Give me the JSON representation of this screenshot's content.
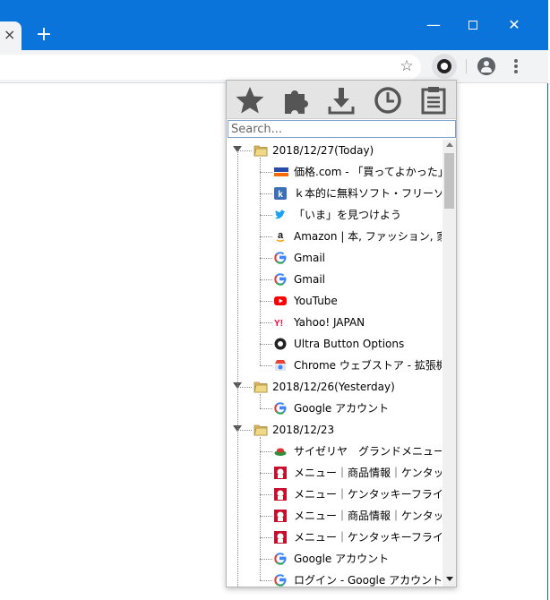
{
  "browser": {
    "tab_close": "×",
    "new_tab": "+",
    "window_controls": {
      "minimize": "—",
      "close": "✕"
    }
  },
  "popup": {
    "toolbar_icons": [
      "star-icon",
      "puzzle-icon",
      "download-icon",
      "clock-icon",
      "clipboard-icon"
    ],
    "search_placeholder": "Search...",
    "groups": [
      {
        "label": "2018/12/27(Today)",
        "items": [
          {
            "label": "価格.com - 「買ってよかった」",
            "icon": "kakaku-favicon"
          },
          {
            "label": "ｋ本的に無料ソフト・フリーソ",
            "icon": "k-favicon"
          },
          {
            "label": "「いま」を見つけよう",
            "icon": "twitter-favicon"
          },
          {
            "label": "Amazon | 本, ファッション, 家電",
            "icon": "amazon-favicon"
          },
          {
            "label": "Gmail",
            "icon": "google-favicon"
          },
          {
            "label": "Gmail",
            "icon": "google-favicon"
          },
          {
            "label": "YouTube",
            "icon": "youtube-favicon"
          },
          {
            "label": "Yahoo! JAPAN",
            "icon": "yahoo-favicon"
          },
          {
            "label": "Ultra Button Options",
            "icon": "ultrabutton-favicon"
          },
          {
            "label": "Chrome ウェブストア - 拡張機能",
            "icon": "webstore-favicon"
          }
        ]
      },
      {
        "label": "2018/12/26(Yesterday)",
        "items": [
          {
            "label": "Google アカウント",
            "icon": "google-favicon"
          }
        ]
      },
      {
        "label": "2018/12/23",
        "items": [
          {
            "label": "サイゼリヤ　グランドメニュー",
            "icon": "saizeriya-favicon"
          },
          {
            "label": "メニュー｜商品情報｜ケンタッキー",
            "icon": "kfc-favicon"
          },
          {
            "label": "メニュー｜ケンタッキーフライド",
            "icon": "kfc-favicon"
          },
          {
            "label": "メニュー｜商品情報｜ケンタッキー",
            "icon": "kfc-favicon"
          },
          {
            "label": "メニュー｜ケンタッキーフライド",
            "icon": "kfc-favicon"
          },
          {
            "label": "Google アカウント",
            "icon": "google-favicon"
          },
          {
            "label": "ログイン - Google アカウント",
            "icon": "google-favicon"
          }
        ]
      }
    ],
    "colors": {
      "google_blue": "#4285f4",
      "youtube_red": "#ff0000",
      "twitter_blue": "#1da1f2",
      "yahoo_red": "#ff0033",
      "kfc_red": "#c8102e"
    }
  }
}
